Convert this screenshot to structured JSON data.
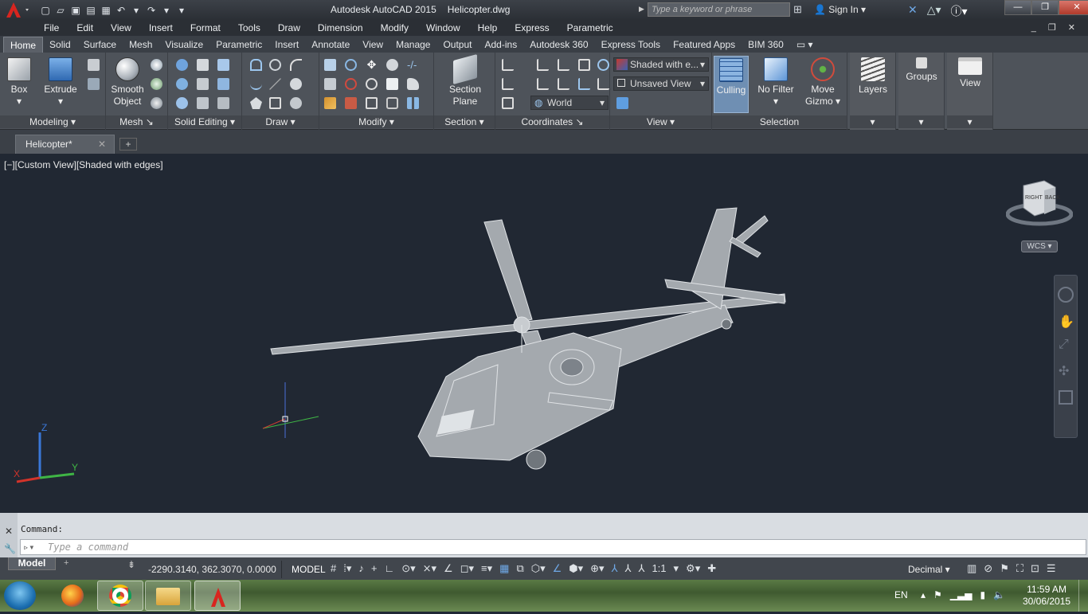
{
  "title": {
    "app": "Autodesk AutoCAD 2015",
    "file": "Helicopter.dwg"
  },
  "search": {
    "placeholder": "Type a keyword or phrase"
  },
  "account": {
    "signin": "Sign In"
  },
  "menu": [
    "File",
    "Edit",
    "View",
    "Insert",
    "Format",
    "Tools",
    "Draw",
    "Dimension",
    "Modify",
    "Window",
    "Help",
    "Express",
    "Parametric"
  ],
  "ribbon_tabs": [
    "Home",
    "Solid",
    "Surface",
    "Mesh",
    "Visualize",
    "Parametric",
    "Insert",
    "Annotate",
    "View",
    "Manage",
    "Output",
    "Add-ins",
    "Autodesk 360",
    "Express Tools",
    "Featured Apps",
    "BIM 360"
  ],
  "panels": {
    "modeling": {
      "label": "Modeling",
      "box": "Box",
      "extrude": "Extrude"
    },
    "mesh": {
      "label": "Mesh",
      "smooth1": "Smooth",
      "smooth2": "Object"
    },
    "solid_editing": {
      "label": "Solid Editing"
    },
    "draw": {
      "label": "Draw"
    },
    "modify": {
      "label": "Modify"
    },
    "section": {
      "label": "Section",
      "sp1": "Section",
      "sp2": "Plane"
    },
    "coordinates": {
      "label": "Coordinates",
      "world": "World"
    },
    "view": {
      "label": "View",
      "visual_style": "Shaded with e...",
      "saved_view": "Unsaved View"
    },
    "selection": {
      "label": "Selection",
      "culling": "Culling",
      "filter": "No Filter",
      "gizmo1": "Move",
      "gizmo2": "Gizmo"
    },
    "layers": {
      "label": "Layers"
    },
    "groups": {
      "label": "Groups"
    },
    "viewp": {
      "label": "View"
    }
  },
  "file_tab": {
    "name": "Helicopter*"
  },
  "viewport": {
    "label": "[−][Custom View][Shaded with edges]",
    "wcs": "WCS",
    "cube_right": "RIGHT",
    "cube_back": "BACK"
  },
  "ucs": {
    "x": "X",
    "y": "Y",
    "z": "Z"
  },
  "command": {
    "history": "Command:",
    "placeholder": "Type a command"
  },
  "status": {
    "model_tab": "Model",
    "coords": "-2290.3140, 362.3070, 0.0000",
    "model": "MODEL",
    "scale": "1:1",
    "units": "Decimal"
  },
  "tray": {
    "lang": "EN",
    "time": "11:59 AM",
    "date": "30/06/2015"
  }
}
